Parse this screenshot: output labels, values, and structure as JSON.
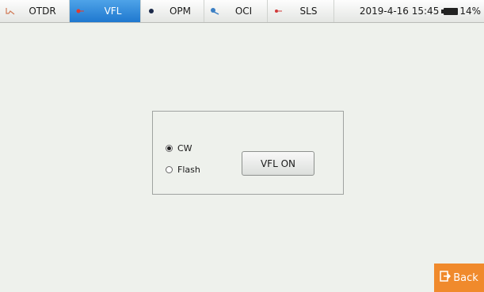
{
  "tabs": [
    {
      "label": "OTDR",
      "icon": "otdr-trace-icon",
      "active": false
    },
    {
      "label": "VFL",
      "icon": "vfl-laser-icon",
      "active": true
    },
    {
      "label": "OPM",
      "icon": "opm-dot-icon",
      "active": false
    },
    {
      "label": "OCI",
      "icon": "oci-probe-icon",
      "active": false
    },
    {
      "label": "SLS",
      "icon": "sls-source-icon",
      "active": false
    }
  ],
  "status": {
    "datetime": "2019-4-16 15:45",
    "battery": "14%"
  },
  "vfl_panel": {
    "modes": [
      {
        "label": "CW",
        "selected": true
      },
      {
        "label": "Flash",
        "selected": false
      }
    ],
    "button_label": "VFL ON"
  },
  "back_button": {
    "label": "Back",
    "icon": "exit-icon"
  },
  "colors": {
    "active_tab": "#1f78cf",
    "background": "#eef1ec",
    "back_button": "#f08a2c"
  }
}
